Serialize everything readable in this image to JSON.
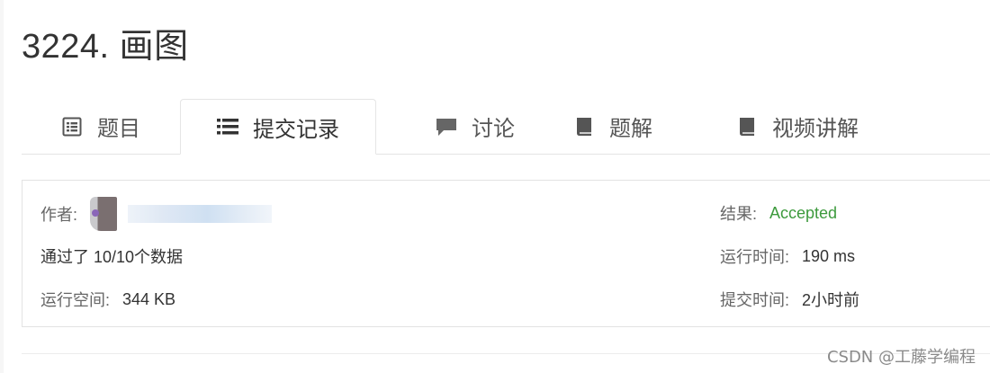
{
  "problem": {
    "title": "3224. 画图"
  },
  "tabs": [
    {
      "label": "题目",
      "icon": "document-icon",
      "active": false
    },
    {
      "label": "提交记录",
      "icon": "list-icon",
      "active": true
    },
    {
      "label": "讨论",
      "icon": "comment-icon",
      "active": false
    },
    {
      "label": "题解",
      "icon": "book-icon",
      "active": false
    },
    {
      "label": "视频讲解",
      "icon": "book-icon",
      "active": false
    }
  ],
  "submission": {
    "author_label": "作者:",
    "passed_text": "通过了 10/10个数据",
    "memory_label": "运行空间:",
    "memory_value": "344 KB",
    "result_label": "结果:",
    "result_value": "Accepted",
    "runtime_label": "运行时间:",
    "runtime_value": "190 ms",
    "submit_time_label": "提交时间:",
    "submit_time_value": "2小时前"
  },
  "colors": {
    "accepted": "#3c9a3c",
    "label": "#666666",
    "border": "#e5e5e5"
  },
  "watermark": "CSDN @工藤学编程"
}
